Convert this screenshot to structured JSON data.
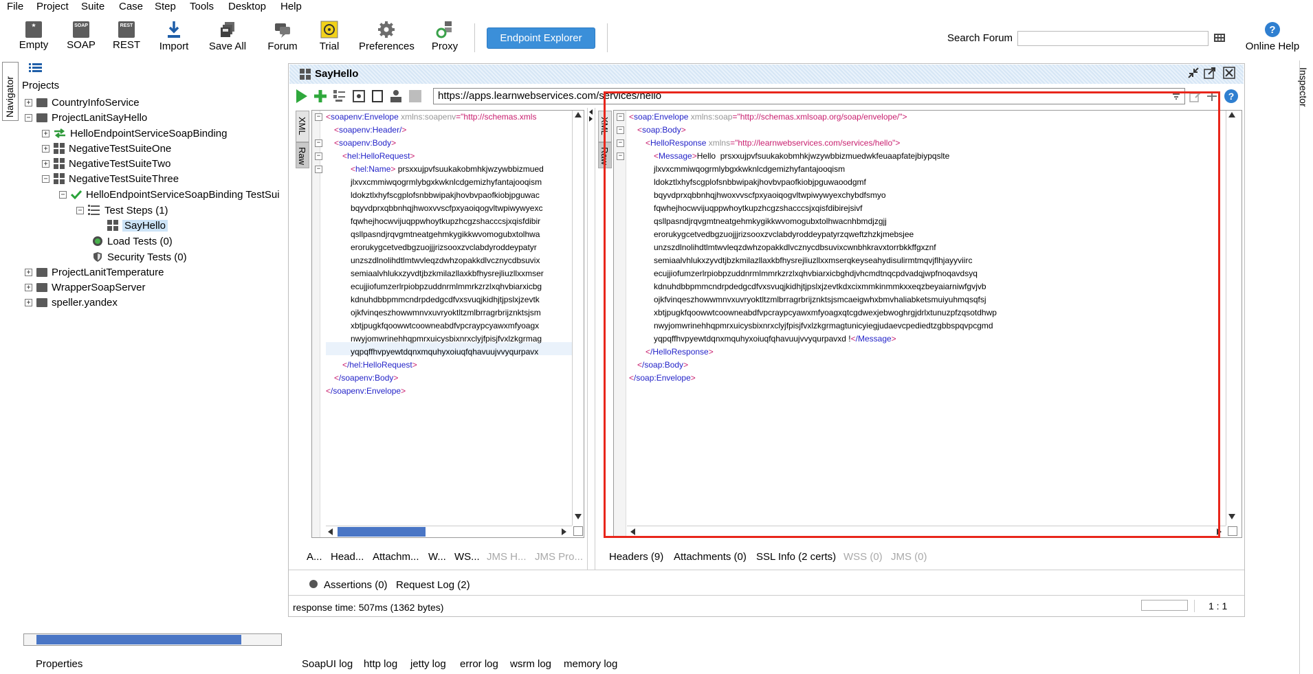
{
  "menu": [
    "File",
    "Project",
    "Suite",
    "Case",
    "Step",
    "Tools",
    "Desktop",
    "Help"
  ],
  "toolbar": {
    "empty": "Empty",
    "soap": "SOAP",
    "rest": "REST",
    "import": "Import",
    "save_all": "Save All",
    "forum": "Forum",
    "trial": "Trial",
    "preferences": "Preferences",
    "proxy": "Proxy",
    "endpoint_explorer": "Endpoint Explorer",
    "search_forum": "Search Forum",
    "online_help": "Online Help",
    "soap_icon_text": "SOAP",
    "rest_icon_text": "REST"
  },
  "navigator": {
    "tab": "Navigator",
    "projects_label": "Projects",
    "items": [
      {
        "label": "CountryInfoService"
      },
      {
        "label": "ProjectLanitSayHello"
      },
      {
        "label": "HelloEndpointServiceSoapBinding"
      },
      {
        "label": "NegativeTestSuiteOne"
      },
      {
        "label": "NegativeTestSuiteTwo"
      },
      {
        "label": "NegativeTestSuiteThree"
      },
      {
        "label": "HelloEndpointServiceSoapBinding TestSui"
      },
      {
        "label": "Test Steps (1)"
      },
      {
        "label": "SayHello"
      },
      {
        "label": "Load Tests (0)"
      },
      {
        "label": "Security Tests (0)"
      },
      {
        "label": "ProjectLanitTemperature"
      },
      {
        "label": "WrapperSoapServer"
      },
      {
        "label": "speller.yandex"
      }
    ],
    "properties": "Properties"
  },
  "editor": {
    "title": "SayHello",
    "url": "https://apps.learnwebservices.com/services/hello",
    "request_tabs": {
      "xml": "XML",
      "raw": "Raw"
    },
    "response_tabs": {
      "xml": "XML",
      "raw": "Raw"
    },
    "request_bottom_tabs": [
      "A...",
      "Head...",
      "Attachm...",
      "W...",
      "WS...",
      "JMS H...",
      "JMS Pro..."
    ],
    "response_bottom_tabs": [
      "Headers (9)",
      "Attachments (0)",
      "SSL Info (2 certs)",
      "WSS (0)",
      "JMS (0)"
    ],
    "assertions": "Assertions (0)",
    "request_log": "Request Log (2)",
    "status": "response time: 507ms (1362 bytes)",
    "position": "1 : 1"
  },
  "request": {
    "envelope_open": "soapenv:Envelope",
    "envelope_attr": "xmlns:soapenv",
    "envelope_val": "\"http://schemas.xmls",
    "header": "soapenv:Header/",
    "body_open": "soapenv:Body",
    "hello_open": "hel:HelloRequest",
    "name_open": "hel:Name",
    "lines": [
      "prsxxujpvfsuukakobmhkjwzywbbizmued",
      "jlxvxcmmiwqogrmlybgxkwknlcdgemizhyfantajooqism",
      "ldokztlxhyfscgplofsnbbwipakjhovbvpaofkiobjpguwac",
      "bqyvdprxqbbnhqjhwoxvvscfpxyaoiqogvltwpiwywyexc",
      "fqwhejhocwvijuqppwhoytkupzhcgzshacccsjxqisfdibir",
      "qsllpasndjrqvgmtneatgehmkygikkwvomogubxtolhwa",
      "erorukygcetvedbgzuojjjrizsooxzvclabdyroddeypatyr",
      "unzszdlnolihdtlmtwvleqzdwhzopakkdlvcznycdbsuvix",
      "semiaalvhlukxzyvdtjbzkmilazllaxkbfhysrejliuzllxxmser",
      "ecujjiofumzerlrpiobpzuddnrmlmmrkzrzlxqhvbiarxicbg",
      "kdnuhdbbpmmcndrpdedgcdfvxsvuqjkidhjtjpslxjzevtk",
      "ojkfvinqeszhowwmnvxuvryoktltzmlbrragrbrijznktsjsm",
      "xbtjpugkfqoowwtcoowneabdfvpcraypcyawxmfyoagx",
      "nwyjomwrinehhqpmrxuicysbixnrxclyjfpisjfvxlzkgrmag",
      "yqpqffhvpyewtdqnxmquhyxoiuqfqhavuujvvyqurpavx"
    ],
    "hello_close": "/hel:HelloRequest",
    "body_close": "/soapenv:Body",
    "envelope_close": "/soapenv:Envelope"
  },
  "response": {
    "envelope_open": "soap:Envelope",
    "envelope_attr": "xmlns:soap",
    "envelope_val": "\"http://schemas.xmlsoap.org/soap/envelope/\"",
    "body_open": "soap:Body",
    "hello_open": "HelloResponse",
    "hello_attr": "xmlns",
    "hello_val": "\"http://learnwebservices.com/services/hello\"",
    "message_open": "Message",
    "first_line": "Hello  prsxxujpvfsuukakobmhkjwzywbbizmuedwkfeuaapfatejbiypqslte",
    "lines": [
      "jlxvxcmmiwqogrmlybgxkwknlcdgemizhyfantajooqism",
      "ldokztlxhyfscgplofsnbbwipakjhovbvpaofkiobjpguwaoodgmf",
      "bqyvdprxqbbnhqjhwoxvvscfpxyaoiqogvltwpiwywyexchybdfsmyo",
      "fqwhejhocwvijuqppwhoytkupzhcgzshacccsjxqisfdibirejsivf",
      "qsllpasndjrqvgmtneatgehmkygikkwvomogubxtolhwacnhbmdjzgjj",
      "erorukygcetvedbgzuojjjrizsooxzvclabdyroddeypatyrzqweftzhzkjmebsjee",
      "unzszdlnolihdtlmtwvleqzdwhzopakkdlvcznycdbsuvixcwnbhkravxtorrbkkffgxznf",
      "semiaalvhlukxzyvdtjbzkmilazllaxkbfhysrejliuzllxxmserqkeyseahydisulirmtmqvjflhjayyviirc",
      "ecujjiofumzerlrpiobpzuddnrmlmmrkzrzlxqhvbiarxicbghdjvhcmdtnqcpdvadqjwpfnoqavdsyq",
      "kdnuhdbbpmmcndrpdedgcdfvxsvuqjkidhjtjpslxjzevtkdxcixmmkinmmkxxeqzbeyaiarniwfgvjvb",
      "ojkfvinqeszhowwmnvxuvryoktltzmlbrragrbrijznktsjsmcaeigwhxbmvhaliabketsmuiyuhmqsqfsj",
      "xbtjpugkfqoowwtcoowneabdfvpcraypcyawxmfyoagxqtcgdwexjebwoghrgjdrlxtunuzpfzqsotdhwp",
      "nwyjomwrinehhqpmrxuicysbixnrxclyjfpisjfvxlzkgrmagtunicyiegjudaevcpediedtzgbbspqvpcgmd"
    ],
    "last_line": "yqpqffhvpyewtdqnxmquhyxoiuqfqhavuujvvyqurpavxd !",
    "message_close": "/Message",
    "hello_close": "/HelloResponse",
    "body_close": "/soap:Body",
    "envelope_close": "/soap:Envelope"
  },
  "logs": [
    "SoapUI log",
    "http log",
    "jetty log",
    "error log",
    "wsrm log",
    "memory log"
  ],
  "inspector": "Inspector",
  "colors": {
    "accent": "#3b8fd9",
    "highlight_box": "#e8261b",
    "tag": "#2323c8",
    "bracket": "#c81e6e"
  }
}
